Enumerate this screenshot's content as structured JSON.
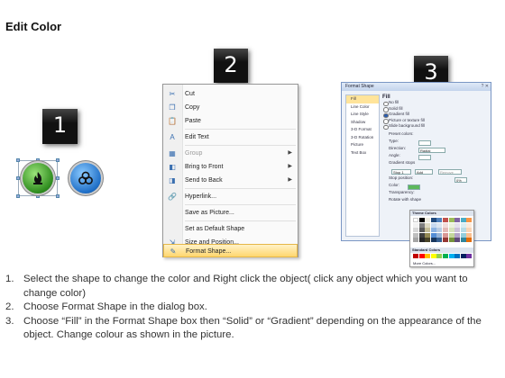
{
  "title": "Edit Color",
  "steps": {
    "one": "1",
    "two": "2",
    "three": "3"
  },
  "shapes": {
    "left_icon": "flame-icon",
    "right_icon": "biohazard-icon",
    "left_color": "#2e8c1e",
    "right_color": "#1f6fc7"
  },
  "context_menu": {
    "items": [
      {
        "label": "Cut",
        "icon": "scissors-icon"
      },
      {
        "label": "Copy",
        "icon": "copy-icon"
      },
      {
        "label": "Paste",
        "icon": "paste-icon"
      },
      {
        "label": "Edit Text",
        "icon": "edit-text-icon"
      },
      {
        "label": "Group",
        "icon": "group-icon"
      },
      {
        "label": "Bring to Front",
        "icon": "bring-front-icon"
      },
      {
        "label": "Send to Back",
        "icon": "send-back-icon"
      },
      {
        "label": "Hyperlink...",
        "icon": "hyperlink-icon"
      },
      {
        "label": "Save as Picture...",
        "icon": ""
      },
      {
        "label": "Set as Default Shape",
        "icon": ""
      },
      {
        "label": "Size and Position...",
        "icon": "size-icon"
      },
      {
        "label": "Format Shape...",
        "icon": "format-shape-icon"
      }
    ]
  },
  "dialog": {
    "title": "Format Shape",
    "sidebar": [
      "Fill",
      "Line Color",
      "Line Style",
      "Shadow",
      "3-D Format",
      "3-D Rotation",
      "Picture",
      "Text Box"
    ],
    "section": "Fill",
    "fill_options": [
      "No fill",
      "Solid fill",
      "Gradient fill",
      "Picture or texture fill",
      "Slide background fill"
    ],
    "fields": [
      "Preset colors:",
      "Type:",
      "Direction:",
      "Angle:",
      "Gradient stops",
      "Stop position:",
      "Color:",
      "Transparency:",
      "Rotate with shape"
    ],
    "type_value": "Radial",
    "stop_value": "Stop 1",
    "add_label": "Add",
    "remove_label": "Remove",
    "stop_pct": "0%",
    "theme_colors": "Theme Colors",
    "standard_colors": "Standard Colors",
    "more_colors": "More Colors..."
  },
  "instructions": [
    {
      "n": "1.",
      "text": "Select the shape to change the color and Right click the object( click any object which you want to change color)"
    },
    {
      "n": "2.",
      "text": "Choose Format Shape in the dialog box."
    },
    {
      "n": "3.",
      "text": "Choose “Fill” in the Format Shape box then “Solid” or “Gradient” depending on the appearance of the object. Change colour as shown in the picture."
    }
  ]
}
